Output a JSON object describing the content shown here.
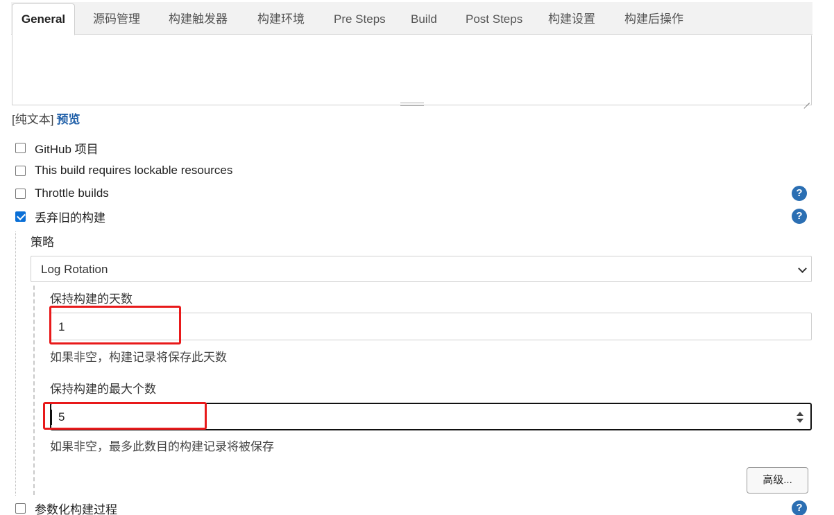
{
  "tabs": [
    {
      "label": "General",
      "active": true
    },
    {
      "label": "源码管理"
    },
    {
      "label": "构建触发器"
    },
    {
      "label": "构建环境"
    },
    {
      "label": "Pre Steps"
    },
    {
      "label": "Build"
    },
    {
      "label": "Post Steps"
    },
    {
      "label": "构建设置"
    },
    {
      "label": "构建后操作"
    }
  ],
  "description": {
    "value": "",
    "format_label": "[纯文本]",
    "preview_link": "预览"
  },
  "options": [
    {
      "label": "GitHub 项目",
      "checked": false,
      "help": false
    },
    {
      "label": "This build requires lockable resources",
      "checked": false,
      "help": false
    },
    {
      "label": "Throttle builds",
      "checked": false,
      "help": true
    },
    {
      "label": "丢弃旧的构建",
      "checked": true,
      "help": true
    }
  ],
  "discard": {
    "strategy_label": "策略",
    "strategy_value": "Log Rotation",
    "days_label": "保持构建的天数",
    "days_value": "1",
    "days_hint": "如果非空，构建记录将保存此天数",
    "max_label": "保持构建的最大个数",
    "max_value": "5",
    "max_hint": "如果非空，最多此数目的构建记录将被保存",
    "advanced_button": "高级..."
  },
  "param_option": {
    "label": "参数化构建过程",
    "checked": false,
    "help": true
  },
  "help_glyph": "?",
  "colors": {
    "accent": "#0a6fd6",
    "help": "#2b6fb3",
    "highlight": "#e8191a",
    "link": "#1f5fa8"
  }
}
